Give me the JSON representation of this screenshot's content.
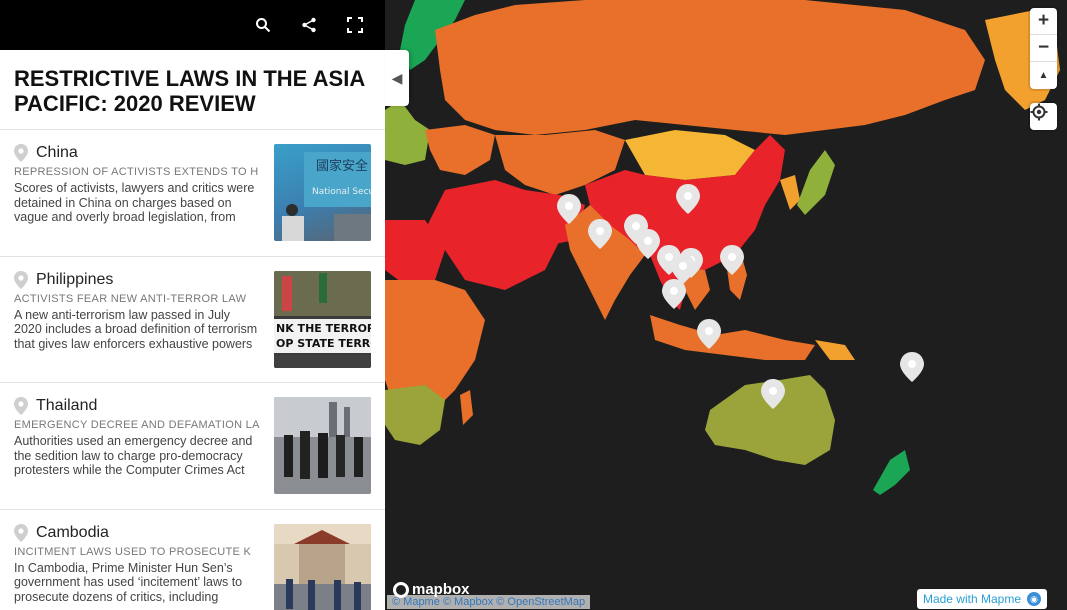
{
  "title": "RESTRICTIVE LAWS IN THE ASIA PACIFIC: 2020 REVIEW",
  "top_icons": [
    "search-icon",
    "share-icon",
    "fullscreen-icon"
  ],
  "stories": [
    {
      "name": "China",
      "subtitle": "REPRESSION OF ACTIVISTS EXTENDS TO H",
      "desc": "Scores of activists, lawyers and critics were detained in China on charges based on vague and overly broad legislation, from ‘subverting state…"
    },
    {
      "name": "Philippines",
      "subtitle": "ACTIVISTS FEAR NEW ANTI-TERROR LAW",
      "desc": "A new anti-terrorism law passed in July 2020 includes a broad definition of terrorism that gives law enforcers exhaustive powers and provides few…"
    },
    {
      "name": "Thailand",
      "subtitle": "EMERGENCY DECREE AND DEFAMATION LA",
      "desc": "Authorities used an emergency decree and the sedition law to charge pro-democracy protesters while the Computer Crimes Act gave authorities…"
    },
    {
      "name": "Cambodia",
      "subtitle": "INCITMENT LAWS USED TO PROSECUTE K",
      "desc": "In Cambodia, Prime Minister Hun Sen’s government has used ‘incitement’ laws to prosecute dozens of critics, including"
    }
  ],
  "thumb_texts": {
    "china": "National Security",
    "china_cn": "國家安全",
    "philippines_1": "NK THE TERROR",
    "philippines_2": "OP STATE TERROR"
  },
  "map": {
    "zoom_in": "+",
    "zoom_out": "−",
    "compass": "▲",
    "locate_icon": "locate-icon",
    "mapbox_logo": "mapbox",
    "attribution": "© Mapme © Mapbox © OpenStreetMap",
    "made_with": "Made with Mapme",
    "colors": {
      "green": "#1aa655",
      "lightgreen": "#8fb03a",
      "olive": "#9aa43a",
      "orange": "#e8702a",
      "lightorange": "#f2a02e",
      "red": "#e8232a",
      "yellow": "#f4b634",
      "ocean": "#1e1e1e"
    }
  }
}
